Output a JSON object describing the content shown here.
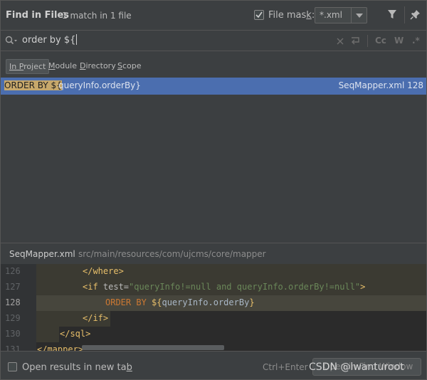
{
  "header": {
    "title": "Find in Files",
    "match_count": "1 match in 1 file",
    "file_mask_label_pre": "File mas",
    "file_mask_label_u": "k",
    "file_mask_label_post": ":",
    "file_mask_checked": true,
    "file_mask_value": "*.xml"
  },
  "search": {
    "query": "order by ${",
    "options": [
      "Cc",
      "W",
      ".*"
    ]
  },
  "scope": {
    "tabs": [
      {
        "pre": "",
        "u": "In P",
        "post": "roject",
        "active": true
      },
      {
        "pre": "",
        "u": "M",
        "post": "odule",
        "active": false
      },
      {
        "pre": "",
        "u": "D",
        "post": "irectory",
        "active": false
      },
      {
        "pre": "",
        "u": "S",
        "post": "cope",
        "active": false
      }
    ]
  },
  "results": [
    {
      "match": "ORDER BY ${",
      "rest": "queryInfo.orderBy}",
      "file": "SeqMapper.xml 128"
    }
  ],
  "preview": {
    "file_name": "SeqMapper.xml",
    "file_path": "src/main/resources/com/ujcms/core/mapper",
    "line_numbers": [
      "126",
      "127",
      "128",
      "129",
      "130",
      "131"
    ],
    "current_line": "128",
    "code": {
      "l126": "</where>",
      "l127_open": "<if ",
      "l127_attr": "test=",
      "l127_str": "\"queryInfo!=null and queryInfo.orderBy!=null\"",
      "l127_close": ">",
      "l128_kw": "ORDER BY ",
      "l128_open": "${",
      "l128_var": "queryInfo.orderBy",
      "l128_close": "}",
      "l129": "</if>",
      "l130": "</sql>",
      "l131": "</mapper>"
    }
  },
  "footer": {
    "open_results_pre": "Open results in new ta",
    "open_results_u": "b",
    "shortcut": "Ctrl+Enter",
    "open_button": "Open in Find Window"
  },
  "watermark": "CSDN @lwanturoot",
  "colors": {
    "selection": "#4b6eaf",
    "match_highlight": "#c7a86b",
    "xml_tag": "#e8bf6a",
    "string": "#6a8759",
    "keyword": "#cc7832"
  }
}
